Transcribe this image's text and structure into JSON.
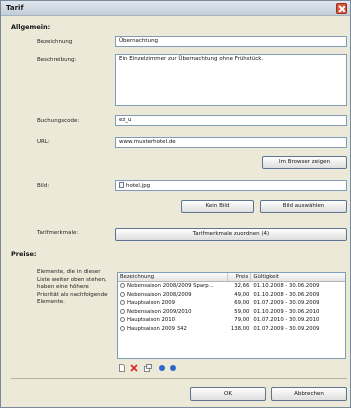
{
  "window": {
    "title": "Tarif"
  },
  "allgemein": {
    "section_label": "Allgemein:",
    "bezeichnung_label": "Bezeichnung",
    "bezeichnung_value": "Übernachtung",
    "beschreibung_label": "Beschreibung:",
    "beschreibung_value": "Ein Einzelzimmer zur Übernachtung ohne Frühstück.",
    "buchungscode_label": "Buchungscode:",
    "buchungscode_value": "ez_u",
    "url_label": "URL:",
    "url_value": "www.musterhotel.de",
    "browser_button": "Im Browser zeigen",
    "bild_label": "Bild:",
    "bild_value": "hotel.jpg",
    "kein_bild_button": "Kein Bild",
    "bild_auswaehlen_button": "Bild auswählen",
    "tarifmerkmale_label": "Tarifmerkmale:",
    "tarifmerkmale_button": "Tarifmerkmale zuordnen (4)"
  },
  "preise": {
    "section_label": "Preise:",
    "description": "Elemente, die in dieser Liste weiter oben stehen, haben eine höhere Priorität als nachfolgende Elemente.",
    "columns": {
      "bezeichnung": "Bezeichnung",
      "preis": "Preis",
      "gueltigkeit": "Gültigkeit"
    },
    "rows": [
      {
        "bezeichnung": "Nebensaison 2008/2009 Sparp...",
        "preis": "32,66",
        "gueltigkeit": "01.10.2008 - 30.06.2009"
      },
      {
        "bezeichnung": "Nebensaison 2008/2009",
        "preis": "49,00",
        "gueltigkeit": "01.10.2008 - 30.06.2009"
      },
      {
        "bezeichnung": "Hauptsaison 2009",
        "preis": "69,00",
        "gueltigkeit": "01.07.2009 - 30.09.2009"
      },
      {
        "bezeichnung": "Nebensaison 2009/2010",
        "preis": "59,00",
        "gueltigkeit": "01.10.2009 - 30.06.2010"
      },
      {
        "bezeichnung": "Hauptsaison 2010",
        "preis": "79,00",
        "gueltigkeit": "01.07.2010 - 30.09.2010"
      },
      {
        "bezeichnung": "Hauptsaison 2009 342",
        "preis": "138,00",
        "gueltigkeit": "01.07.2009 - 30.09.2009"
      }
    ]
  },
  "footer": {
    "ok_button": "OK",
    "abbrechen_button": "Abbrechen"
  }
}
